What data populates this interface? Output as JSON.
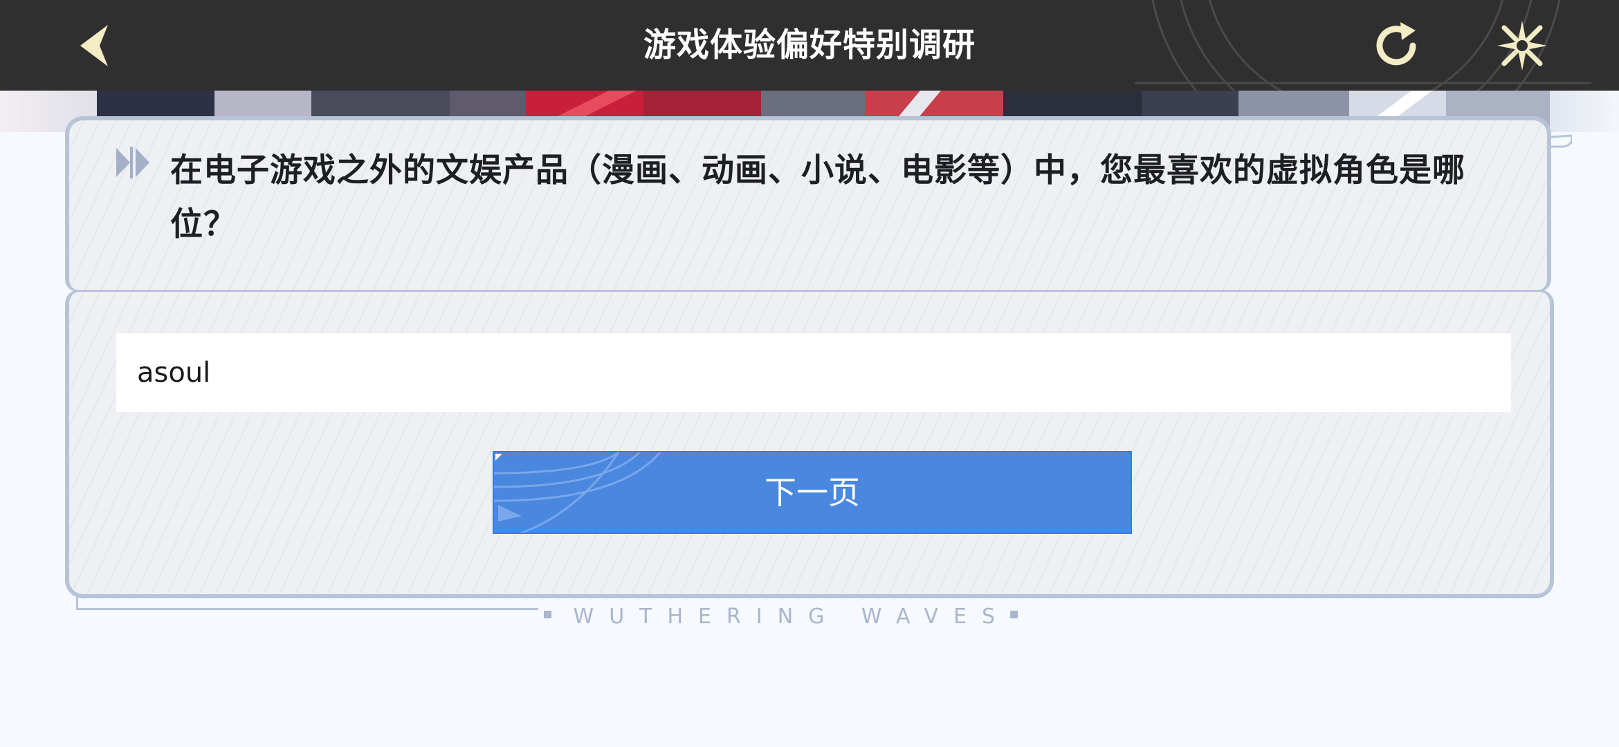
{
  "header": {
    "title": "游戏体验偏好特别调研",
    "back_icon": "chevron-left-icon",
    "refresh_icon": "refresh-icon",
    "close_icon": "close-star-icon",
    "background_color": "#2f2f2f",
    "icon_color": "#f3ecc4"
  },
  "question": {
    "text": "在电子游戏之外的文娱产品（漫画、动画、小说、电影等）中，您最喜欢的虚拟角色是哪位？"
  },
  "answer": {
    "value": "asoul"
  },
  "actions": {
    "next_label": "下一页",
    "accent_color": "#4a87df"
  },
  "footer": {
    "brand": "WUTHERING WAVES"
  }
}
